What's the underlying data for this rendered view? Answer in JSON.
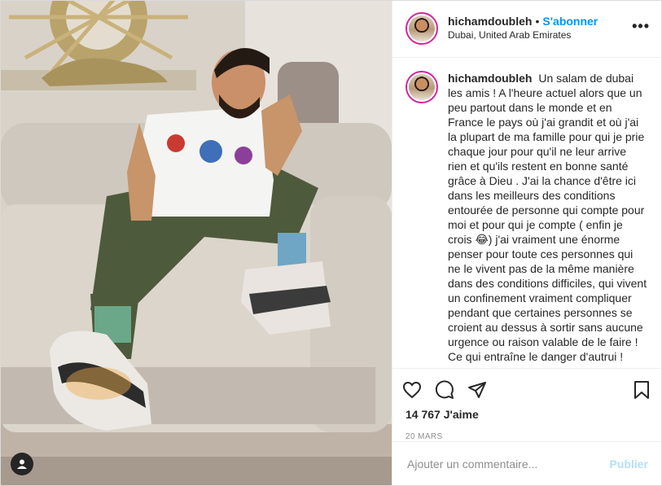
{
  "post": {
    "username": "hichamdoubleh",
    "separator": "•",
    "follow_label": "S'abonner",
    "location": "Dubai, United Arab Emirates",
    "more_label": "•••"
  },
  "caption": {
    "username": "hichamdoubleh",
    "text": "Un salam de dubai les amis ! A l'heure actuel alors que un peu partout dans le monde et en France le pays où j'ai grandit et où j'ai la plupart de ma famille pour qui je prie chaque jour pour qu'il ne leur arrive rien et qu'ils restent en bonne santé grâce à Dieu . J'ai la chance d'être ici dans les meilleurs des conditions entourée de personne qui compte pour moi et pour qui je compte ( enfin je crois 😂) j'ai vraiment une énorme penser pour toute ces personnes qui ne le vivent pas de la même manière dans des conditions difficiles, qui vivent un confinement vraiment compliquer pendant que certaines personnes se croient au dessus à sortir sans aucune urgence ou raison valable de le faire ! Ce qui entraîne le danger d'autrui !"
  },
  "stats": {
    "likes": "14 767 J'aime",
    "date": "20 MARS"
  },
  "comment_box": {
    "placeholder": "Ajouter un commentaire...",
    "publish_label": "Publier"
  },
  "icons": {
    "like": "heart-icon",
    "comment": "comment-icon",
    "share": "share-icon",
    "save": "bookmark-icon",
    "tags": "user-tag-icon"
  },
  "colors": {
    "accent": "#0095f6",
    "publish_disabled": "#b2dffc",
    "text": "#262626",
    "muted": "#8e8e8e"
  }
}
